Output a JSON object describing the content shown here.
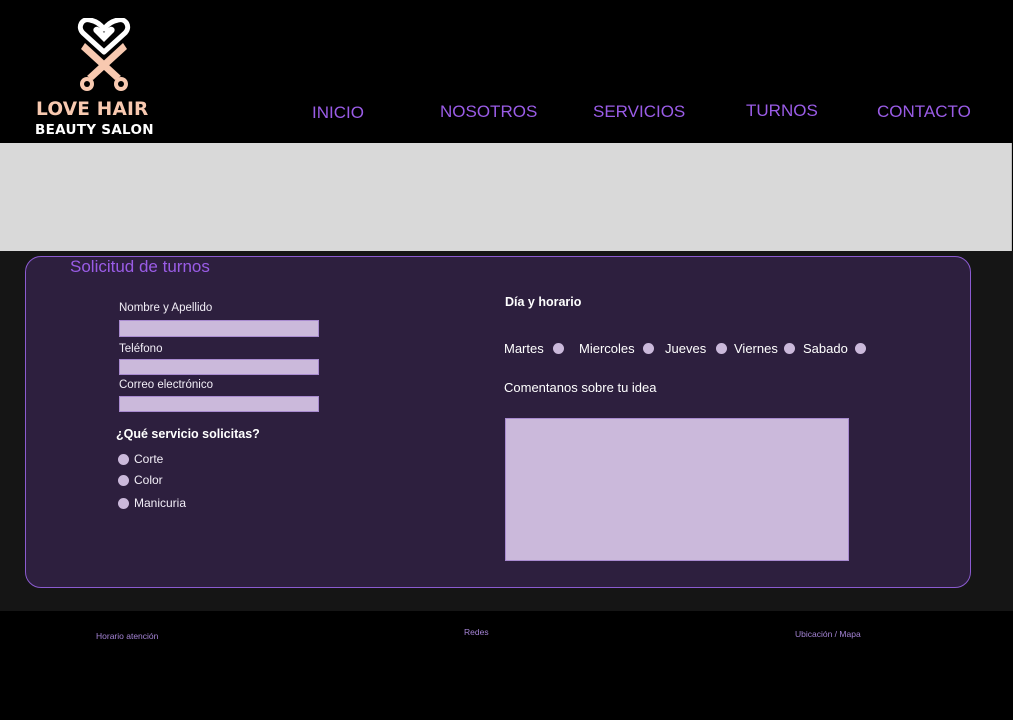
{
  "brand": {
    "name": "LOVE HAIR",
    "tagline": "BEAUTY SALON",
    "logo_icon": "heart-scissors-icon"
  },
  "nav": {
    "items": [
      "INICIO",
      "NOSOTROS",
      "SERVICIOS",
      "TURNOS",
      "CONTACTO"
    ]
  },
  "form": {
    "title": "Solicitud de turnos",
    "name_label": "Nombre y Apellido",
    "phone_label": "Teléfono",
    "email_label": "Correo electrónico",
    "service_question": "¿Qué servicio solicitas?",
    "services": [
      "Corte",
      "Color",
      "Manicuria"
    ],
    "schedule_label": "Día y horario",
    "days": [
      "Martes",
      "Miercoles",
      "Jueves",
      "Viernes",
      "Sabado"
    ],
    "comments_label": "Comentanos sobre tu idea"
  },
  "footer": {
    "hours": "Horario atención",
    "social": "Redes",
    "location": "Ubicación / Mapa"
  },
  "colors": {
    "accent": "#9a5ce6",
    "panel": "#2d1f3e",
    "field": "#cbb9db",
    "brand": "#f8c9b0"
  }
}
